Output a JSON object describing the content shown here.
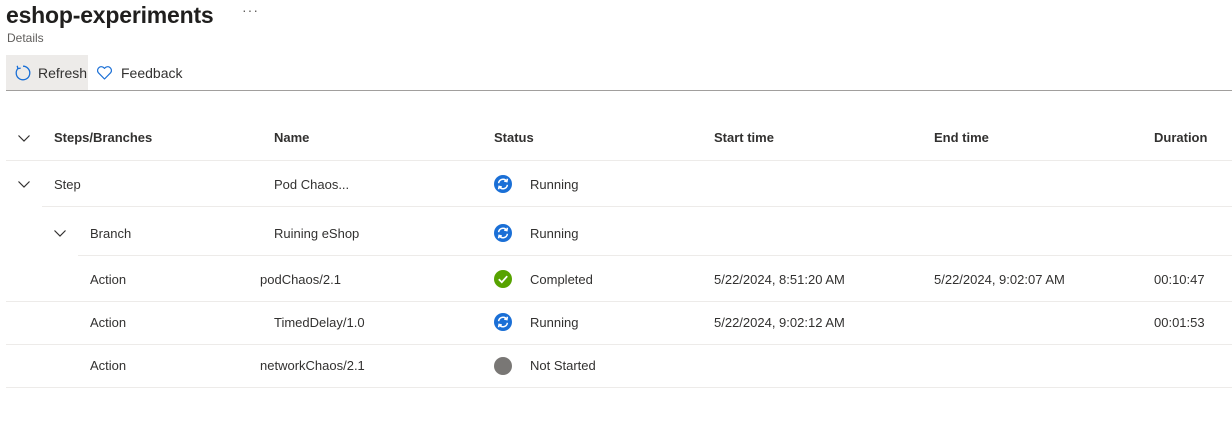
{
  "page": {
    "title": "eshop-experiments",
    "subtitle": "Details",
    "more": "···"
  },
  "toolbar": {
    "refresh": "Refresh",
    "feedback": "Feedback"
  },
  "columns": {
    "steps": "Steps/Branches",
    "name": "Name",
    "status": "Status",
    "start": "Start time",
    "end": "End time",
    "duration": "Duration"
  },
  "rows": [
    {
      "type": "Step",
      "name": "Pod Chaos...",
      "status": "Running",
      "status_icon": "running-icon",
      "start": "",
      "end": "",
      "duration": ""
    },
    {
      "type": "Branch",
      "name": "Ruining eShop",
      "status": "Running",
      "status_icon": "running-icon",
      "start": "",
      "end": "",
      "duration": ""
    },
    {
      "type": "Action",
      "name": "podChaos/2.1",
      "status": "Completed",
      "status_icon": "completed-icon",
      "start": "5/22/2024, 8:51:20 AM",
      "end": "5/22/2024, 9:02:07 AM",
      "duration": "00:10:47"
    },
    {
      "type": "Action",
      "name": "TimedDelay/1.0",
      "status": "Running",
      "status_icon": "running-icon",
      "start": "5/22/2024, 9:02:12 AM",
      "end": "",
      "duration": "00:01:53"
    },
    {
      "type": "Action",
      "name": "networkChaos/2.1",
      "status": "Not Started",
      "status_icon": "not-started-icon",
      "start": "",
      "end": "",
      "duration": ""
    }
  ],
  "colors": {
    "running": "#1a6fd6",
    "completed": "#57a300",
    "not_started": "#797775"
  }
}
